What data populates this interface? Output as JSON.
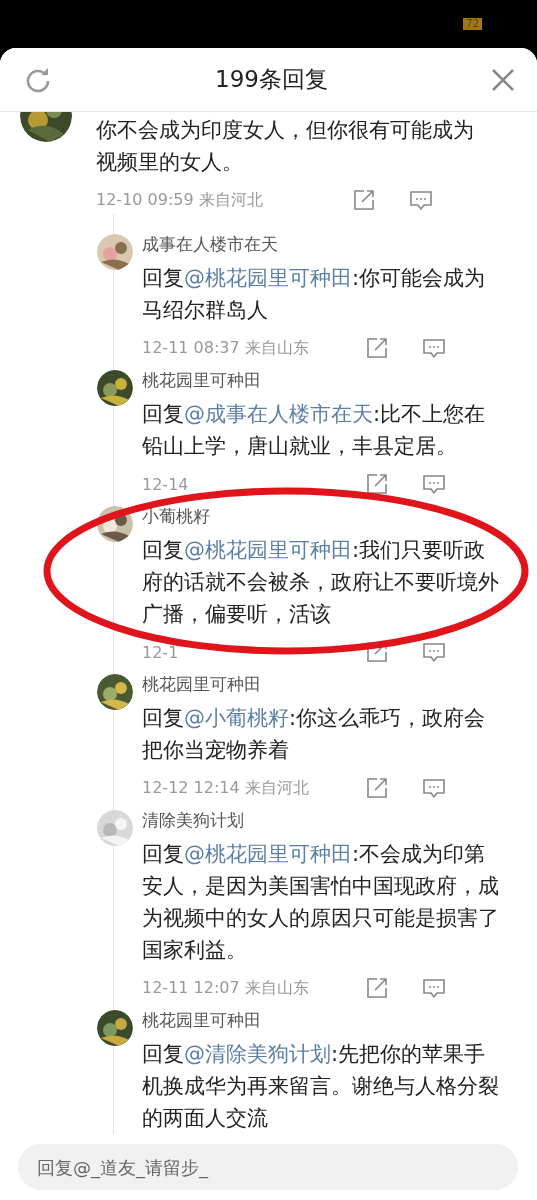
{
  "status_bar": {
    "battery": "72"
  },
  "header": {
    "title": "199条回复"
  },
  "comment": {
    "text": "你不会成为印度女人，但你很有可能成为视频里的女人。",
    "time": "12-10 09:59",
    "location": "来自河北",
    "replies": [
      {
        "user": "成事在人楼市在天",
        "prefix": "回复",
        "mention": "@桃花园里可种田",
        "body": ":你可能会成为马绍尔群岛人",
        "time": "12-11 08:37",
        "location": "来自山东"
      },
      {
        "user": "桃花园里可种田",
        "prefix": "回复",
        "mention": "@成事在人楼市在天",
        "body": ":比不上您在铅山上学，唐山就业，丰县定居。",
        "time": "12-14"
      },
      {
        "user": "小葡桃籽",
        "prefix": "回复",
        "mention": "@桃花园里可种田",
        "body": ":我们只要听政府的话就不会被杀，政府让不要听境外广播，偏要听，活该",
        "time": "12-1"
      },
      {
        "user": "桃花园里可种田",
        "prefix": "回复",
        "mention": "@小葡桃籽",
        "body": ":你这么乖巧，政府会把你当宠物养着",
        "time": "12-12 12:14",
        "location": "来自河北"
      },
      {
        "user": "清除美狗计划",
        "prefix": "回复",
        "mention": "@桃花园里可种田",
        "body": ":不会成为印第安人，是因为美国害怕中国现政府，成为视频中的女人的原因只可能是损害了国家利益。",
        "time": "12-11 12:07",
        "location": "来自山东"
      },
      {
        "user": "桃花园里可种田",
        "prefix": "回复",
        "mention": "@清除美狗计划",
        "body": ":先把你的苹果手机换成华为再来留言。谢绝与人格分裂的两面人交流"
      }
    ]
  },
  "reply_box": {
    "placeholder": "回复@_道友_请留步_"
  },
  "annotation": {
    "kind": "ellipse",
    "color": "#e0141b"
  }
}
